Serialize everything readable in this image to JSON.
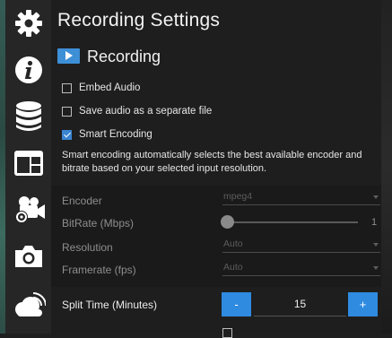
{
  "page_title": "Recording Settings",
  "section": {
    "title": "Recording",
    "icon": "play-icon"
  },
  "sidebar": {
    "items": [
      {
        "name": "settings",
        "icon": "gear-icon"
      },
      {
        "name": "info",
        "icon": "info-icon"
      },
      {
        "name": "storage",
        "icon": "database-icon"
      },
      {
        "name": "layout",
        "icon": "layout-icon"
      },
      {
        "name": "camera-settings",
        "icon": "video-camera-gear-icon"
      },
      {
        "name": "snapshot",
        "icon": "camera-icon"
      },
      {
        "name": "cloud",
        "icon": "cloud-icon"
      }
    ]
  },
  "checkboxes": {
    "embed_audio": {
      "label": "Embed Audio",
      "checked": false
    },
    "separate_audio": {
      "label": "Save audio as a separate file",
      "checked": false
    },
    "smart_encoding": {
      "label": "Smart Encoding",
      "checked": true
    }
  },
  "description": "Smart encoding automatically selects the best available encoder and bitrate based on your selected input resolution.",
  "form": {
    "encoder": {
      "label": "Encoder",
      "value": "mpeg4"
    },
    "bitrate": {
      "label": "BitRate (Mbps)",
      "value": "1",
      "fraction": 0.0
    },
    "resolution": {
      "label": "Resolution",
      "value": "Auto"
    },
    "framerate": {
      "label": "Framerate (fps)",
      "value": "Auto"
    }
  },
  "split_time": {
    "label": "Split Time (Minutes)",
    "value": "15",
    "minus": "-",
    "plus": "+"
  },
  "colors": {
    "accent": "#2f8be0",
    "checked": "#3a84d0",
    "section_icon": "#3d8fd6"
  }
}
